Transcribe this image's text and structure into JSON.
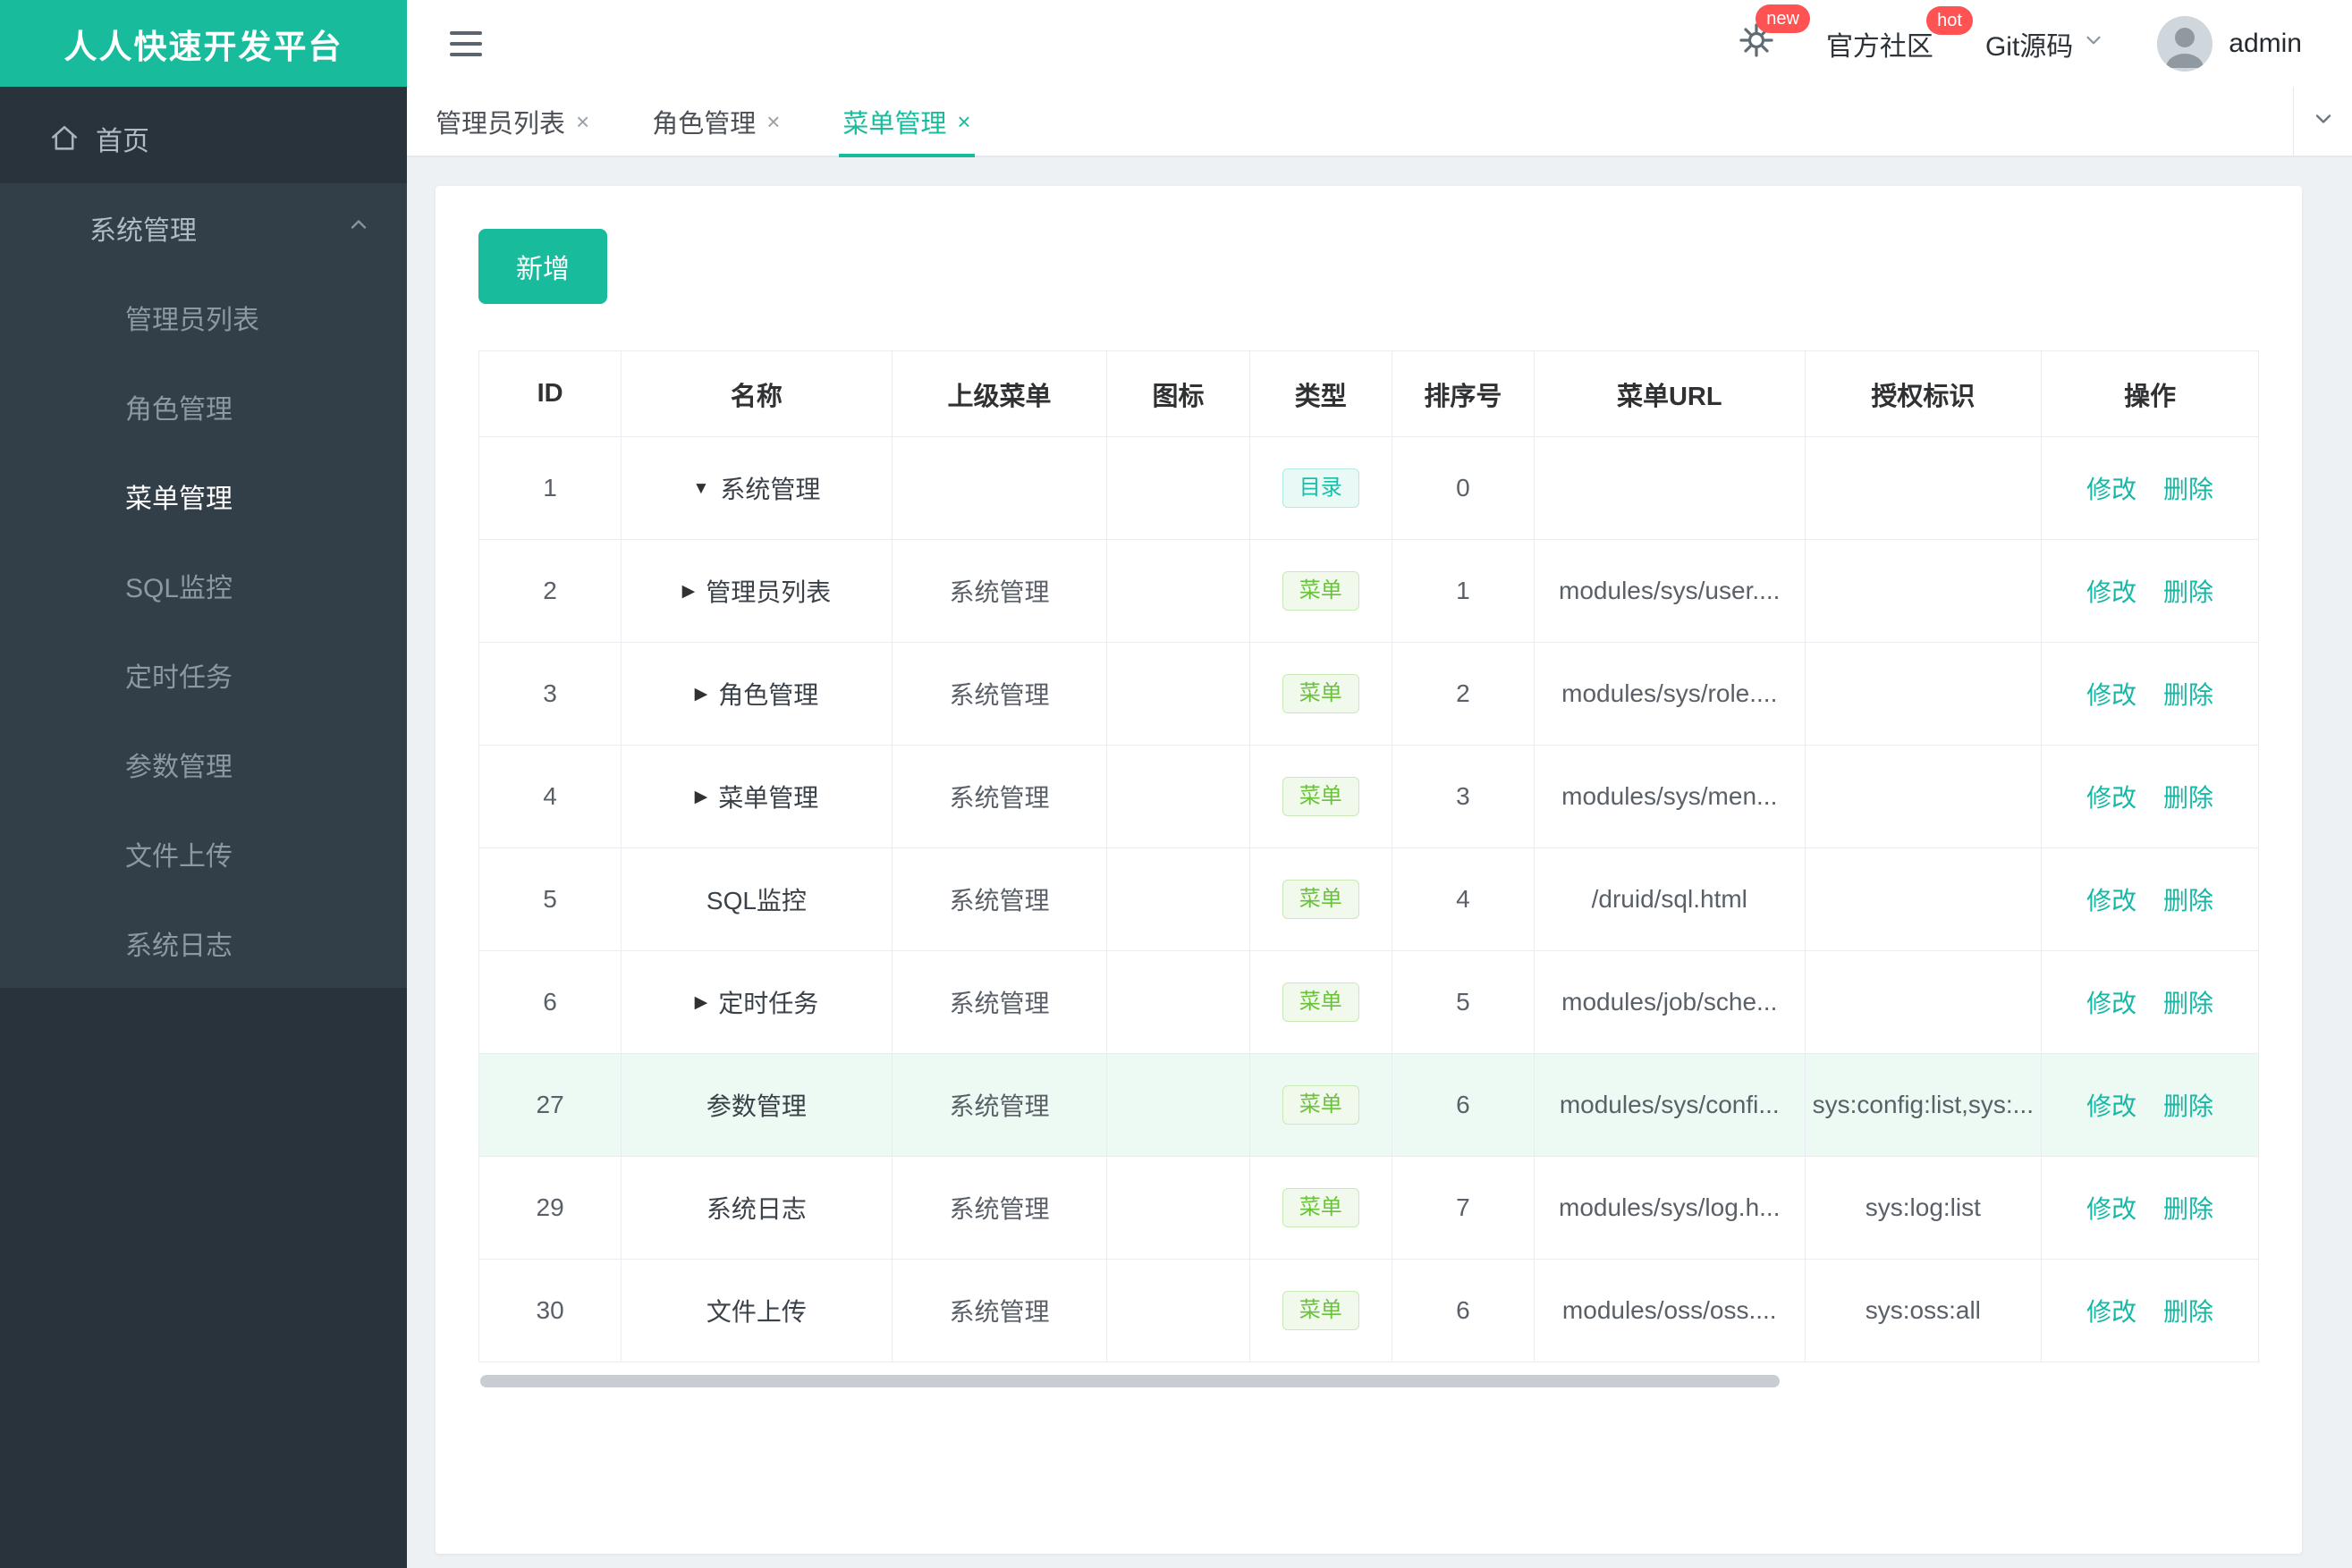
{
  "app": {
    "title": "人人快速开发平台"
  },
  "topbar": {
    "notice_badge": "new",
    "community_label": "官方社区",
    "community_badge": "hot",
    "git_label": "Git源码",
    "username": "admin"
  },
  "sidebar": {
    "home_label": "首页",
    "group_label": "系统管理",
    "items": [
      {
        "label": "管理员列表",
        "active": false
      },
      {
        "label": "角色管理",
        "active": false
      },
      {
        "label": "菜单管理",
        "active": true
      },
      {
        "label": "SQL监控",
        "active": false
      },
      {
        "label": "定时任务",
        "active": false
      },
      {
        "label": "参数管理",
        "active": false
      },
      {
        "label": "文件上传",
        "active": false
      },
      {
        "label": "系统日志",
        "active": false
      }
    ]
  },
  "tabs": [
    {
      "label": "管理员列表",
      "active": false
    },
    {
      "label": "角色管理",
      "active": false
    },
    {
      "label": "菜单管理",
      "active": true
    }
  ],
  "toolbar": {
    "add_label": "新增"
  },
  "table": {
    "headers": [
      "ID",
      "名称",
      "上级菜单",
      "图标",
      "类型",
      "排序号",
      "菜单URL",
      "授权标识",
      "操作"
    ],
    "edit_label": "修改",
    "delete_label": "删除",
    "rows": [
      {
        "id": "1",
        "name": "系统管理",
        "expander": "down",
        "parent": "",
        "icon": "",
        "type": "目录",
        "type_kind": "dir",
        "order": "0",
        "url": "",
        "perms": "",
        "highlight": false
      },
      {
        "id": "2",
        "name": "管理员列表",
        "expander": "right",
        "parent": "系统管理",
        "icon": "",
        "type": "菜单",
        "type_kind": "menu",
        "order": "1",
        "url": "modules/sys/user....",
        "perms": "",
        "highlight": false
      },
      {
        "id": "3",
        "name": "角色管理",
        "expander": "right",
        "parent": "系统管理",
        "icon": "",
        "type": "菜单",
        "type_kind": "menu",
        "order": "2",
        "url": "modules/sys/role....",
        "perms": "",
        "highlight": false
      },
      {
        "id": "4",
        "name": "菜单管理",
        "expander": "right",
        "parent": "系统管理",
        "icon": "",
        "type": "菜单",
        "type_kind": "menu",
        "order": "3",
        "url": "modules/sys/men...",
        "perms": "",
        "highlight": false
      },
      {
        "id": "5",
        "name": "SQL监控",
        "expander": "none",
        "parent": "系统管理",
        "icon": "",
        "type": "菜单",
        "type_kind": "menu",
        "order": "4",
        "url": "/druid/sql.html",
        "perms": "",
        "highlight": false
      },
      {
        "id": "6",
        "name": "定时任务",
        "expander": "right",
        "parent": "系统管理",
        "icon": "",
        "type": "菜单",
        "type_kind": "menu",
        "order": "5",
        "url": "modules/job/sche...",
        "perms": "",
        "highlight": false
      },
      {
        "id": "27",
        "name": "参数管理",
        "expander": "none",
        "parent": "系统管理",
        "icon": "",
        "type": "菜单",
        "type_kind": "menu",
        "order": "6",
        "url": "modules/sys/confi...",
        "perms": "sys:config:list,sys:...",
        "highlight": true
      },
      {
        "id": "29",
        "name": "系统日志",
        "expander": "none",
        "parent": "系统管理",
        "icon": "",
        "type": "菜单",
        "type_kind": "menu",
        "order": "7",
        "url": "modules/sys/log.h...",
        "perms": "sys:log:list",
        "highlight": false
      },
      {
        "id": "30",
        "name": "文件上传",
        "expander": "none",
        "parent": "系统管理",
        "icon": "",
        "type": "菜单",
        "type_kind": "menu",
        "order": "6",
        "url": "modules/oss/oss....",
        "perms": "sys:oss:all",
        "highlight": false
      }
    ]
  },
  "icons": {
    "menu_toggle": "hamburger",
    "settings": "gear",
    "home": "house",
    "group_state": "chevron-up",
    "git_dropdown": "chevron-down",
    "tabs_dropdown": "chevron-down",
    "tab_close": "×",
    "expand_open": "▼",
    "expand_closed": "▶",
    "user_avatar": "person-silhouette"
  },
  "colors": {
    "brand": "#18bc9c",
    "badge_red": "#ff5252",
    "tag_dir": "#1cbda8",
    "tag_menu": "#6ac13c",
    "sidebar_bg": "#29333b",
    "row_highlight": "#edf9f3"
  }
}
